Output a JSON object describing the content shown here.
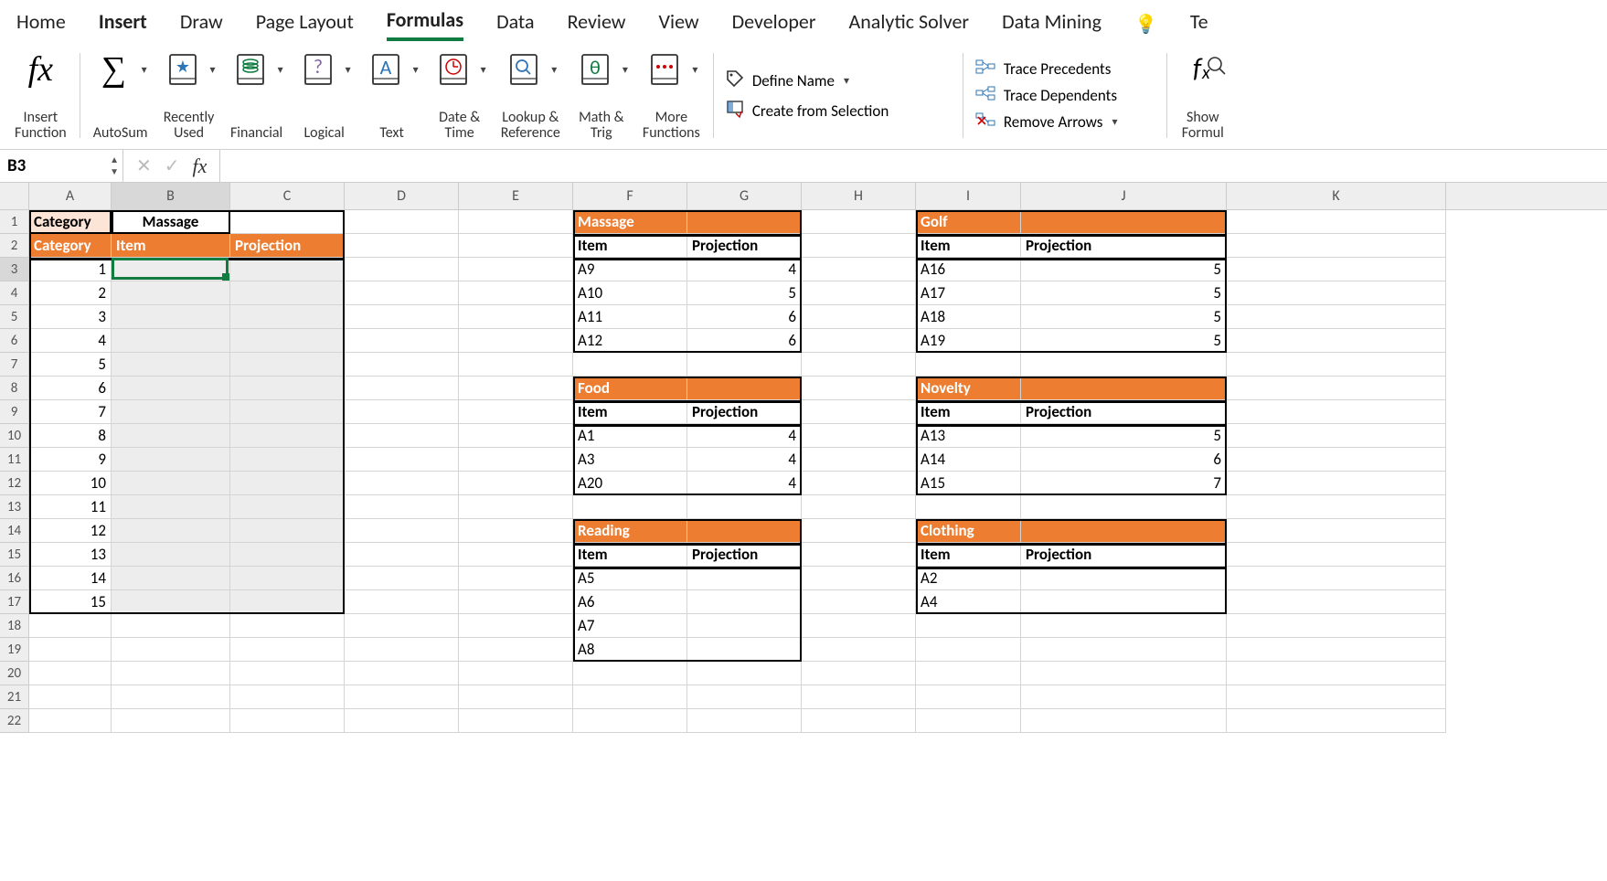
{
  "tabs": [
    "Home",
    "Insert",
    "Draw",
    "Page Layout",
    "Formulas",
    "Data",
    "Review",
    "View",
    "Developer",
    "Analytic Solver",
    "Data Mining",
    "Te"
  ],
  "active_tab": "Formulas",
  "ribbon": {
    "insert_function": "Insert\nFunction",
    "autosum": "AutoSum",
    "recently_used": "Recently\nUsed",
    "financial": "Financial",
    "logical": "Logical",
    "text": "Text",
    "date_time": "Date &\nTime",
    "lookup_ref": "Lookup &\nReference",
    "math_trig": "Math &\nTrig",
    "more_fn": "More\nFunctions",
    "define_name": "Define Name",
    "create_sel": "Create from Selection",
    "trace_prec": "Trace Precedents",
    "trace_dep": "Trace Dependents",
    "remove_arrows": "Remove Arrows",
    "show_formulas": "Show\nFormul"
  },
  "namebox": "B3",
  "formula": "",
  "columns": [
    "A",
    "B",
    "C",
    "D",
    "E",
    "F",
    "G",
    "H",
    "I",
    "J",
    "K"
  ],
  "rows": [
    "1",
    "2",
    "3",
    "4",
    "5",
    "6",
    "7",
    "8",
    "9",
    "10",
    "11",
    "12",
    "13",
    "14",
    "15",
    "16",
    "17",
    "18",
    "19",
    "20",
    "21",
    "22"
  ],
  "A1": "Category",
  "B1": "Massage",
  "A2": "Category",
  "B2": "Item",
  "C2": "Projection",
  "Acol": [
    "1",
    "2",
    "3",
    "4",
    "5",
    "6",
    "7",
    "8",
    "9",
    "10",
    "11",
    "12",
    "13",
    "14",
    "15"
  ],
  "F1": "Massage",
  "F2": "Item",
  "G2": "Projection",
  "massage": [
    [
      "A9",
      "4"
    ],
    [
      "A10",
      "5"
    ],
    [
      "A11",
      "6"
    ],
    [
      "A12",
      "6"
    ]
  ],
  "F8": "Food",
  "F9i": "Item",
  "G9p": "Projection",
  "food": [
    [
      "A1",
      "4"
    ],
    [
      "A3",
      "4"
    ],
    [
      "A20",
      "4"
    ]
  ],
  "F14": "Reading",
  "F15i": "Item",
  "G15p": "Projection",
  "reading": [
    [
      "A5",
      ""
    ],
    [
      "A6",
      ""
    ],
    [
      "A7",
      ""
    ],
    [
      "A8",
      ""
    ]
  ],
  "I1": "Golf",
  "I2": "Item",
  "J2": "Projection",
  "golf": [
    [
      "A16",
      "5"
    ],
    [
      "A17",
      "5"
    ],
    [
      "A18",
      "5"
    ],
    [
      "A19",
      "5"
    ]
  ],
  "I8": "Novelty",
  "I9i": "Item",
  "J9p": "Projection",
  "novelty": [
    [
      "A13",
      "5"
    ],
    [
      "A14",
      "6"
    ],
    [
      "A15",
      "7"
    ]
  ],
  "I14": "Clothing",
  "I15i": "Item",
  "J15p": "Projection",
  "clothing": [
    [
      "A2",
      ""
    ],
    [
      "A4",
      ""
    ]
  ]
}
